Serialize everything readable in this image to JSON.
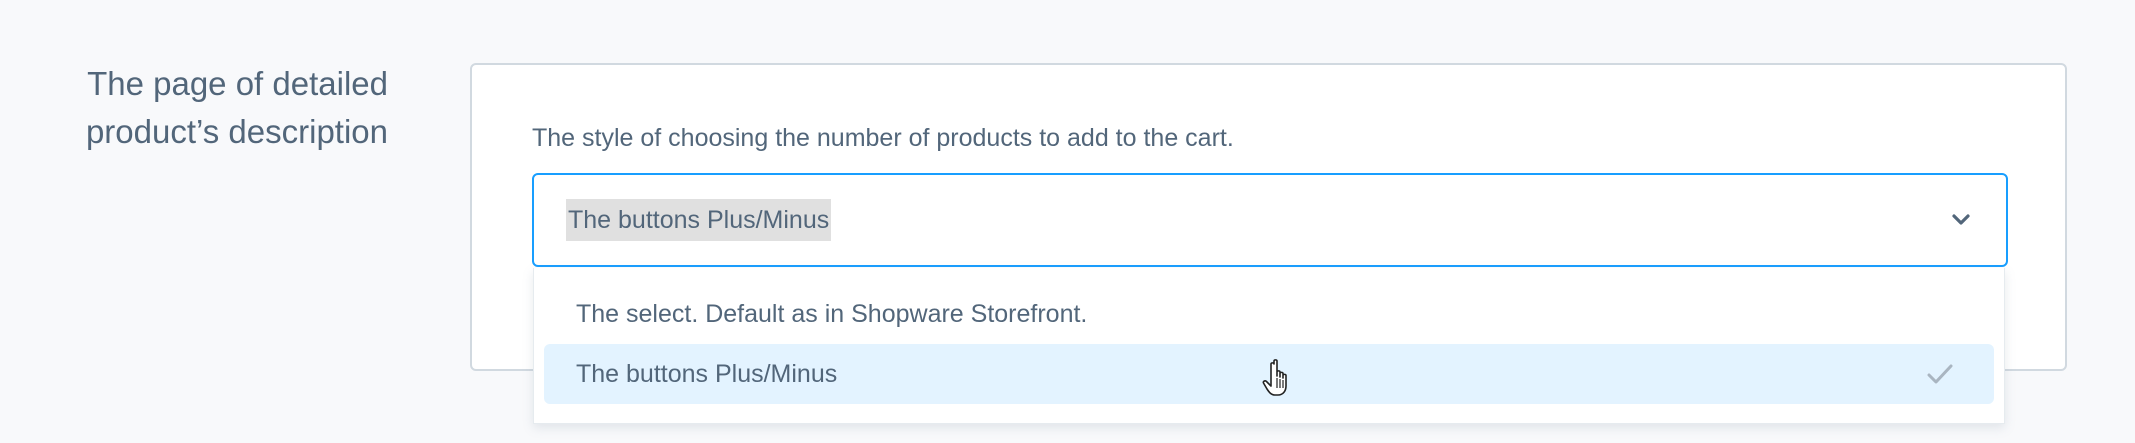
{
  "section": {
    "title_line1": "The page of detailed",
    "title_line2": "product’s description"
  },
  "field": {
    "label": "The style of choosing the number of products to add to the cart.",
    "selected_value": "The buttons Plus/Minus",
    "chevron_icon": "chevron-down-icon"
  },
  "dropdown": {
    "options": [
      {
        "label": "The select. Default as in Shopware Storefront.",
        "selected": false
      },
      {
        "label": "The buttons Plus/Minus",
        "selected": true,
        "icon": "check-icon"
      }
    ]
  },
  "colors": {
    "focus_border": "#189eff",
    "option_highlight": "#e3f3ff",
    "text": "#52667a"
  },
  "cursor": {
    "icon": "hand-pointer-icon"
  }
}
